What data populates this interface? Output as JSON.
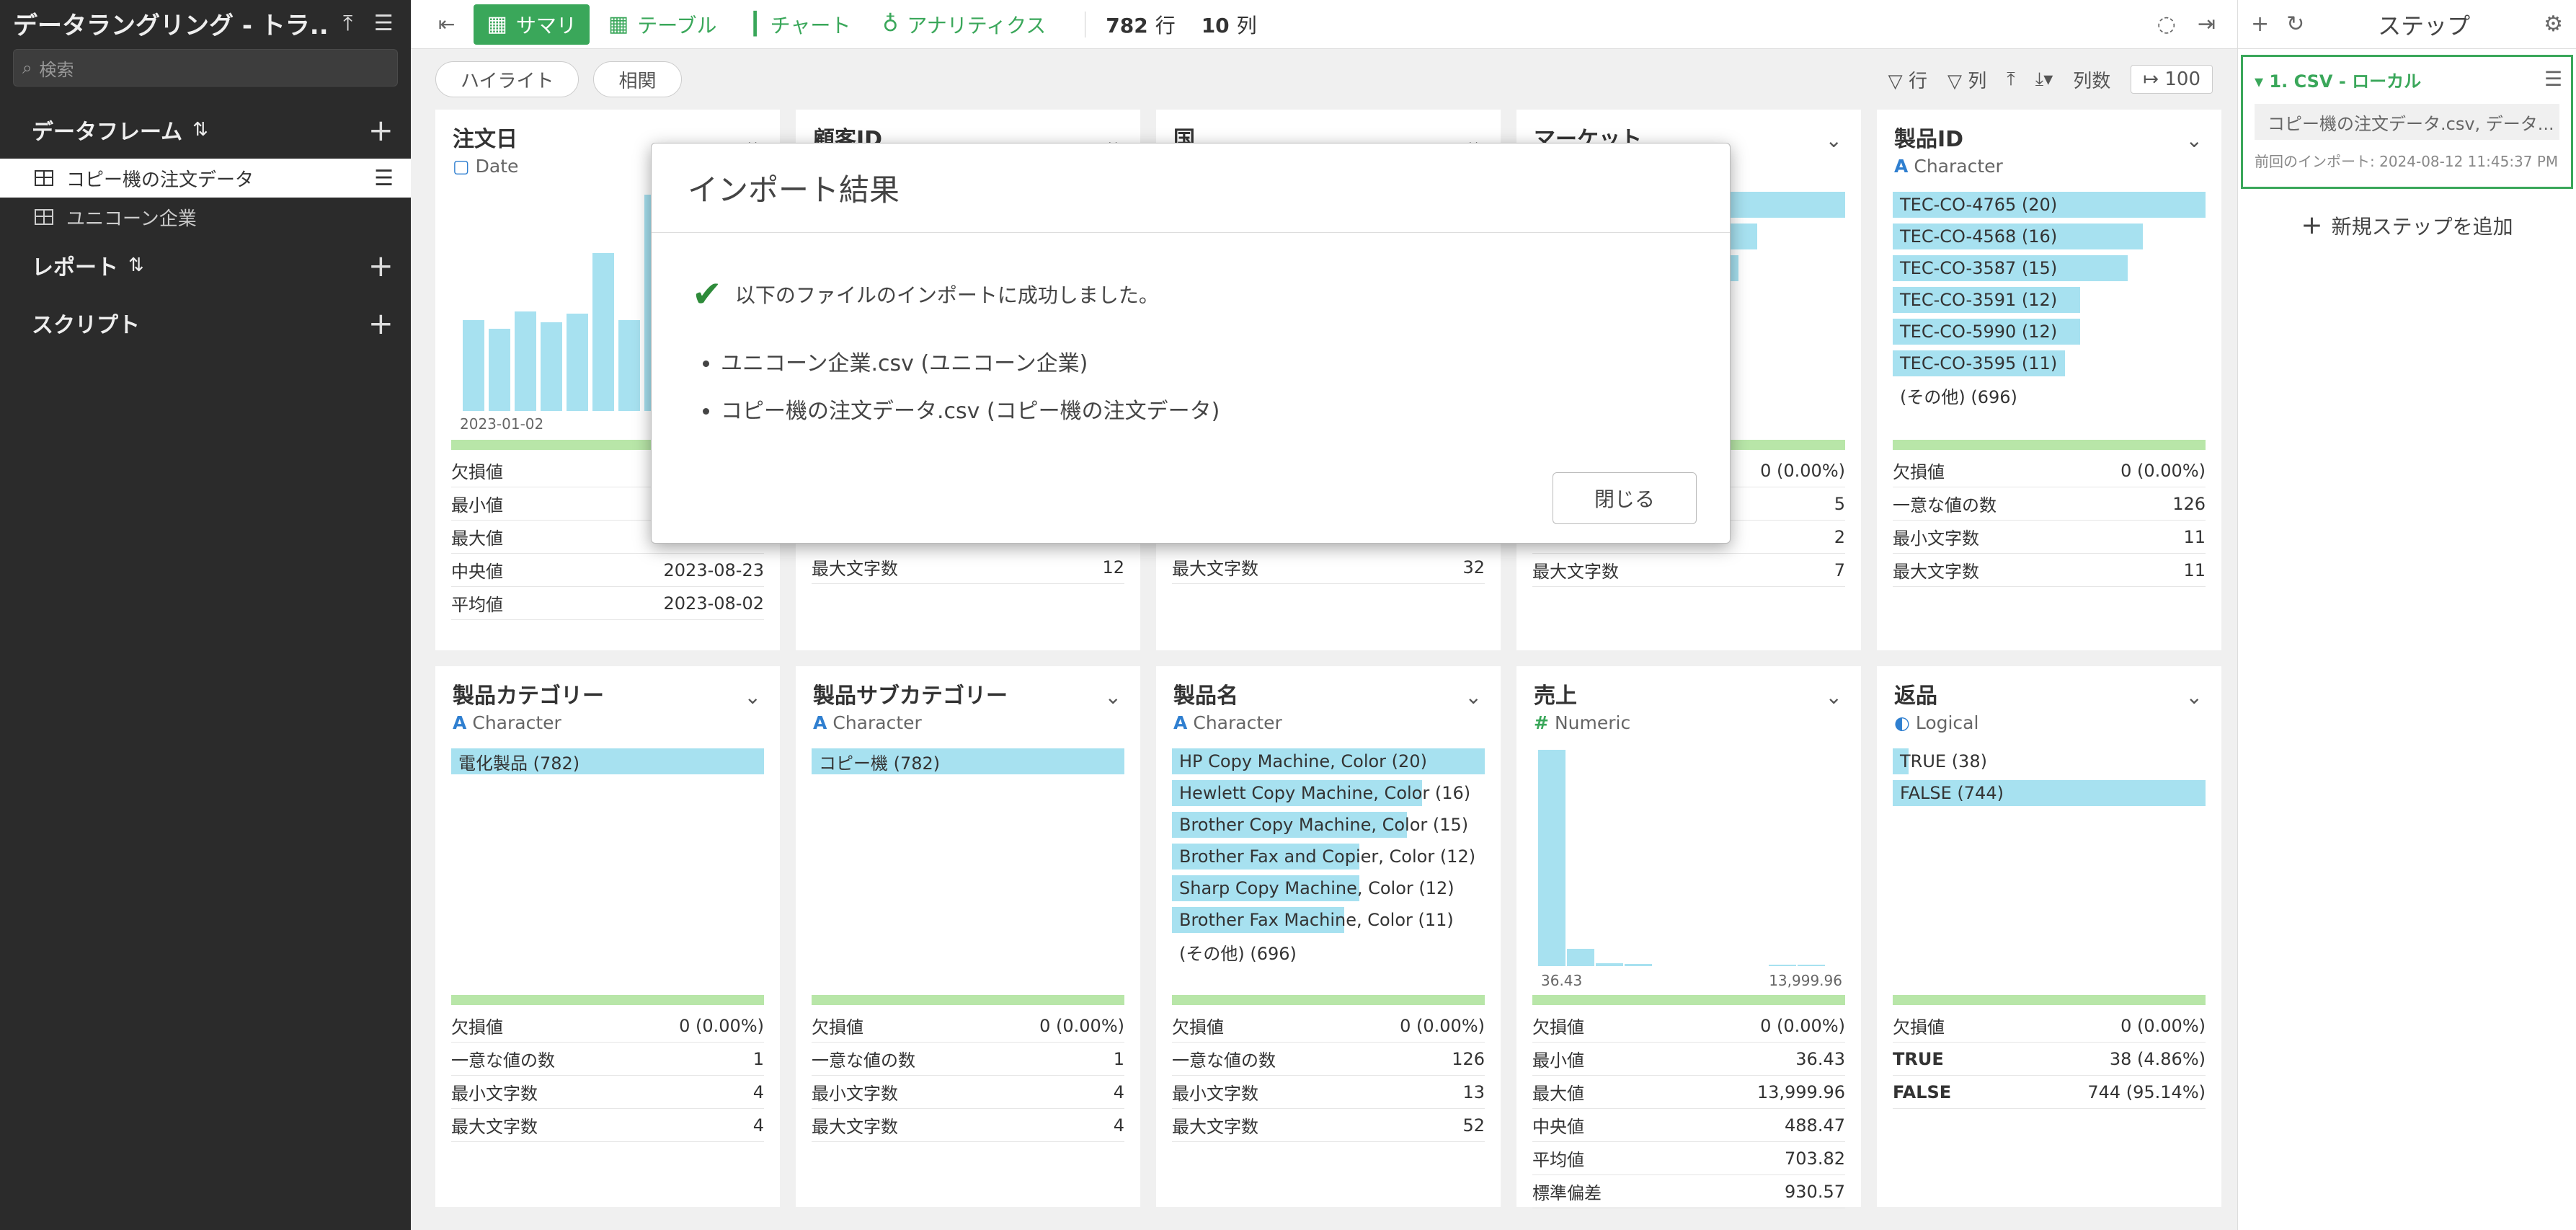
{
  "sidebar": {
    "title": "データラングリング - トラ...",
    "search_placeholder": "検索",
    "dataframe_section": "データフレーム",
    "dataframes": [
      "コピー機の注文データ",
      "ユニコーン企業"
    ],
    "report_section": "レポート",
    "script_section": "スクリプト"
  },
  "toolbar": {
    "summary": "サマリ",
    "table": "テーブル",
    "chart": "チャート",
    "analytics": "アナリティクス",
    "rows_count": "782",
    "rows_label": "行",
    "cols_count": "10",
    "cols_label": "列"
  },
  "subbar": {
    "highlight": "ハイライト",
    "correlation": "相関",
    "filter_rows": "行",
    "filter_cols": "列",
    "col_count_label": "列数",
    "col_count_value": "100"
  },
  "cards": {
    "order_date": {
      "name": "注文日",
      "type": "Date",
      "axis_start": "2023-01-02",
      "stats": [
        {
          "k": "欠損値",
          "v": ""
        },
        {
          "k": "最小値",
          "v": ""
        },
        {
          "k": "最大値",
          "v": ""
        },
        {
          "k": "中央値",
          "v": "2023-08-23"
        },
        {
          "k": "平均値",
          "v": "2023-08-02"
        }
      ]
    },
    "customer_id": {
      "name": "顧客ID",
      "stat_k": "最大文字数",
      "stat_v": "12"
    },
    "country": {
      "name": "国",
      "stat_k": "最大文字数",
      "stat_v": "32"
    },
    "market": {
      "name": "マーケット",
      "stats": [
        {
          "k": "",
          "v": "0 (0.00%)"
        },
        {
          "k": "",
          "v": "5"
        },
        {
          "k": "",
          "v": "2"
        },
        {
          "k": "最大文字数",
          "v": "7"
        }
      ],
      "bar_values": [
        1.0,
        0.72,
        0.66
      ]
    },
    "product_id": {
      "name": "製品ID",
      "type": "Character",
      "bars": [
        {
          "label": "TEC-CO-4765 (20)",
          "value": 20
        },
        {
          "label": "TEC-CO-4568 (16)",
          "value": 16
        },
        {
          "label": "TEC-CO-3587 (15)",
          "value": 15
        },
        {
          "label": "TEC-CO-3591 (12)",
          "value": 12
        },
        {
          "label": "TEC-CO-5990 (12)",
          "value": 12
        },
        {
          "label": "TEC-CO-3595 (11)",
          "value": 11
        }
      ],
      "other": "(その他) (696)",
      "stats": [
        {
          "k": "欠損値",
          "v": "0 (0.00%)"
        },
        {
          "k": "一意な値の数",
          "v": "126"
        },
        {
          "k": "最小文字数",
          "v": "11"
        },
        {
          "k": "最大文字数",
          "v": "11"
        }
      ]
    },
    "category": {
      "name": "製品カテゴリー",
      "type": "Character",
      "bars": [
        {
          "label": "電化製品 (782)",
          "value": 782
        }
      ],
      "stats": [
        {
          "k": "欠損値",
          "v": "0 (0.00%)"
        },
        {
          "k": "一意な値の数",
          "v": "1"
        },
        {
          "k": "最小文字数",
          "v": "4"
        },
        {
          "k": "最大文字数",
          "v": "4"
        }
      ]
    },
    "subcategory": {
      "name": "製品サブカテゴリー",
      "type": "Character",
      "bars": [
        {
          "label": "コピー機 (782)",
          "value": 782
        }
      ],
      "stats": [
        {
          "k": "欠損値",
          "v": "0 (0.00%)"
        },
        {
          "k": "一意な値の数",
          "v": "1"
        },
        {
          "k": "最小文字数",
          "v": "4"
        },
        {
          "k": "最大文字数",
          "v": "4"
        }
      ]
    },
    "product_name": {
      "name": "製品名",
      "type": "Character",
      "bars": [
        {
          "label": "HP Copy Machine, Color (20)",
          "value": 20
        },
        {
          "label": "Hewlett Copy Machine, Color (16)",
          "value": 16
        },
        {
          "label": "Brother Copy Machine, Color (15)",
          "value": 15
        },
        {
          "label": "Brother Fax and Copier, Color (12)",
          "value": 12
        },
        {
          "label": "Sharp Copy Machine, Color (12)",
          "value": 12
        },
        {
          "label": "Brother Fax Machine, Color (11)",
          "value": 11
        }
      ],
      "other": "(その他) (696)",
      "stats": [
        {
          "k": "欠損値",
          "v": "0 (0.00%)"
        },
        {
          "k": "一意な値の数",
          "v": "126"
        },
        {
          "k": "最小文字数",
          "v": "13"
        },
        {
          "k": "最大文字数",
          "v": "52"
        }
      ]
    },
    "sales": {
      "name": "売上",
      "type": "Numeric",
      "axis_min": "36.43",
      "axis_max": "13,999.96",
      "hist": [
        1.0,
        0.08,
        0.015,
        0.01,
        0,
        0,
        0,
        0,
        0.006,
        0.004
      ],
      "stats": [
        {
          "k": "欠損値",
          "v": "0 (0.00%)"
        },
        {
          "k": "最小値",
          "v": "36.43"
        },
        {
          "k": "最大値",
          "v": "13,999.96"
        },
        {
          "k": "中央値",
          "v": "488.47"
        },
        {
          "k": "平均値",
          "v": "703.82"
        },
        {
          "k": "標準偏差",
          "v": "930.57"
        }
      ]
    },
    "returns": {
      "name": "返品",
      "type": "Logical",
      "bars": [
        {
          "label": "TRUE (38)",
          "value": 38
        },
        {
          "label": "FALSE (744)",
          "value": 744
        }
      ],
      "stats": [
        {
          "k": "欠損値",
          "v": "0 (0.00%)"
        },
        {
          "k": "TRUE",
          "v": "38 (4.86%)"
        },
        {
          "k": "FALSE",
          "v": "744 (95.14%)"
        }
      ]
    }
  },
  "order_date_hist": [
    0.42,
    0.38,
    0.46,
    0.41,
    0.45,
    0.73,
    0.42,
    1.0
  ],
  "steps": {
    "title": "ステップ",
    "step_title": "1. CSV - ローカル",
    "step_file": "コピー機の注文データ.csv, データ...",
    "step_meta": "前回のインポート: 2024-08-12 11:45:37 PM",
    "add_step": "新規ステップを追加"
  },
  "modal": {
    "title": "インポート結果",
    "message": "以下のファイルのインポートに成功しました。",
    "files": [
      "ユニコーン企業.csv  (ユニコーン企業)",
      "コピー機の注文データ.csv  (コピー機の注文データ)"
    ],
    "close": "閉じる"
  }
}
